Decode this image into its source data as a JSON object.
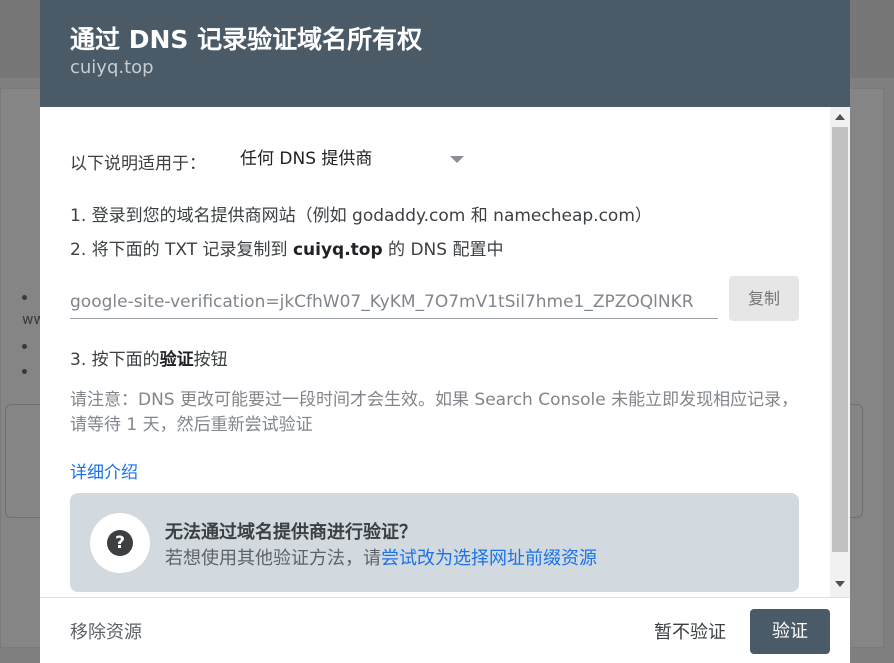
{
  "dialog": {
    "title": "通过 DNS 记录验证域名所有权",
    "subtitle": "cuiyq.top"
  },
  "body": {
    "apply_label": "以下说明适用于：",
    "provider_select": {
      "selected": "任何 DNS 提供商"
    },
    "step1": "1. 登录到您的域名提供商网站（例如 godaddy.com 和 namecheap.com）",
    "step2": {
      "prefix": "2. 将下面的 TXT 记录复制到 ",
      "domain": "cuiyq.top",
      "suffix": " 的 DNS 配置中"
    },
    "txt_record": "google-site-verification=jkCfhW07_KyKM_7O7mV1tSil7hme1_ZPZOQlNKR",
    "copy_label": "复制",
    "step3": {
      "prefix": "3. 按下面的",
      "bold": "验证",
      "suffix": "按钮"
    },
    "note": "请注意：DNS 更改可能要过一段时间才会生效。如果 Search Console 未能立即发现相应记录，请等待 1 天，然后重新尝试验证",
    "learn_more": "详细介绍",
    "help_card": {
      "title": "无法通过域名提供商进行验证？",
      "desc_prefix": "若想使用其他验证方法，请",
      "link": "尝试改为选择网址前缀资源"
    }
  },
  "footer": {
    "remove": "移除资源",
    "skip": "暂不验证",
    "verify": "验证"
  },
  "colors": {
    "header_bg": "#4a5a67",
    "link": "#1a73e8",
    "help_card_bg": "#d3dadf"
  }
}
